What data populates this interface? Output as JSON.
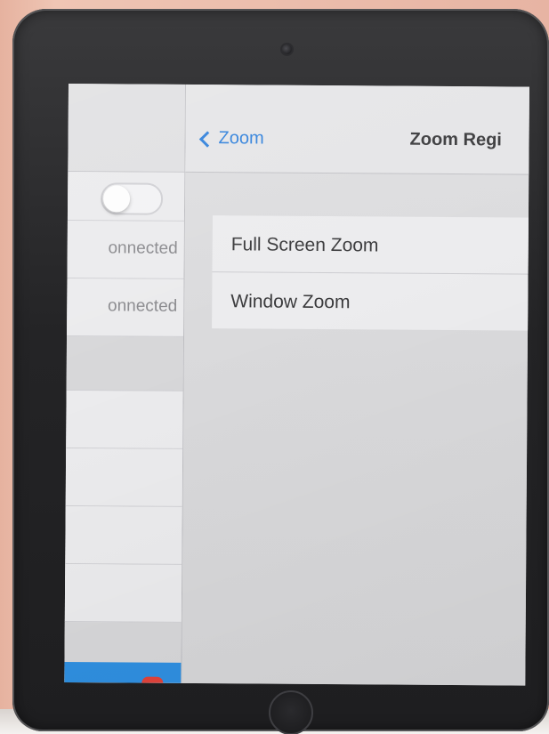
{
  "left_pane": {
    "rows": [
      {
        "text": "onnected"
      },
      {
        "text": "onnected"
      }
    ]
  },
  "detail": {
    "back_label": "Zoom",
    "title": "Zoom Regi",
    "options": [
      {
        "label": "Full Screen Zoom"
      },
      {
        "label": "Window Zoom"
      }
    ]
  },
  "colors": {
    "accent": "#2f80db",
    "toggle_off": "#f2f2f4",
    "selected_strip": "#2f8fe0"
  },
  "icons": {
    "back": "chevron-left-icon",
    "camera": "camera-icon",
    "home": "home-button-icon"
  }
}
